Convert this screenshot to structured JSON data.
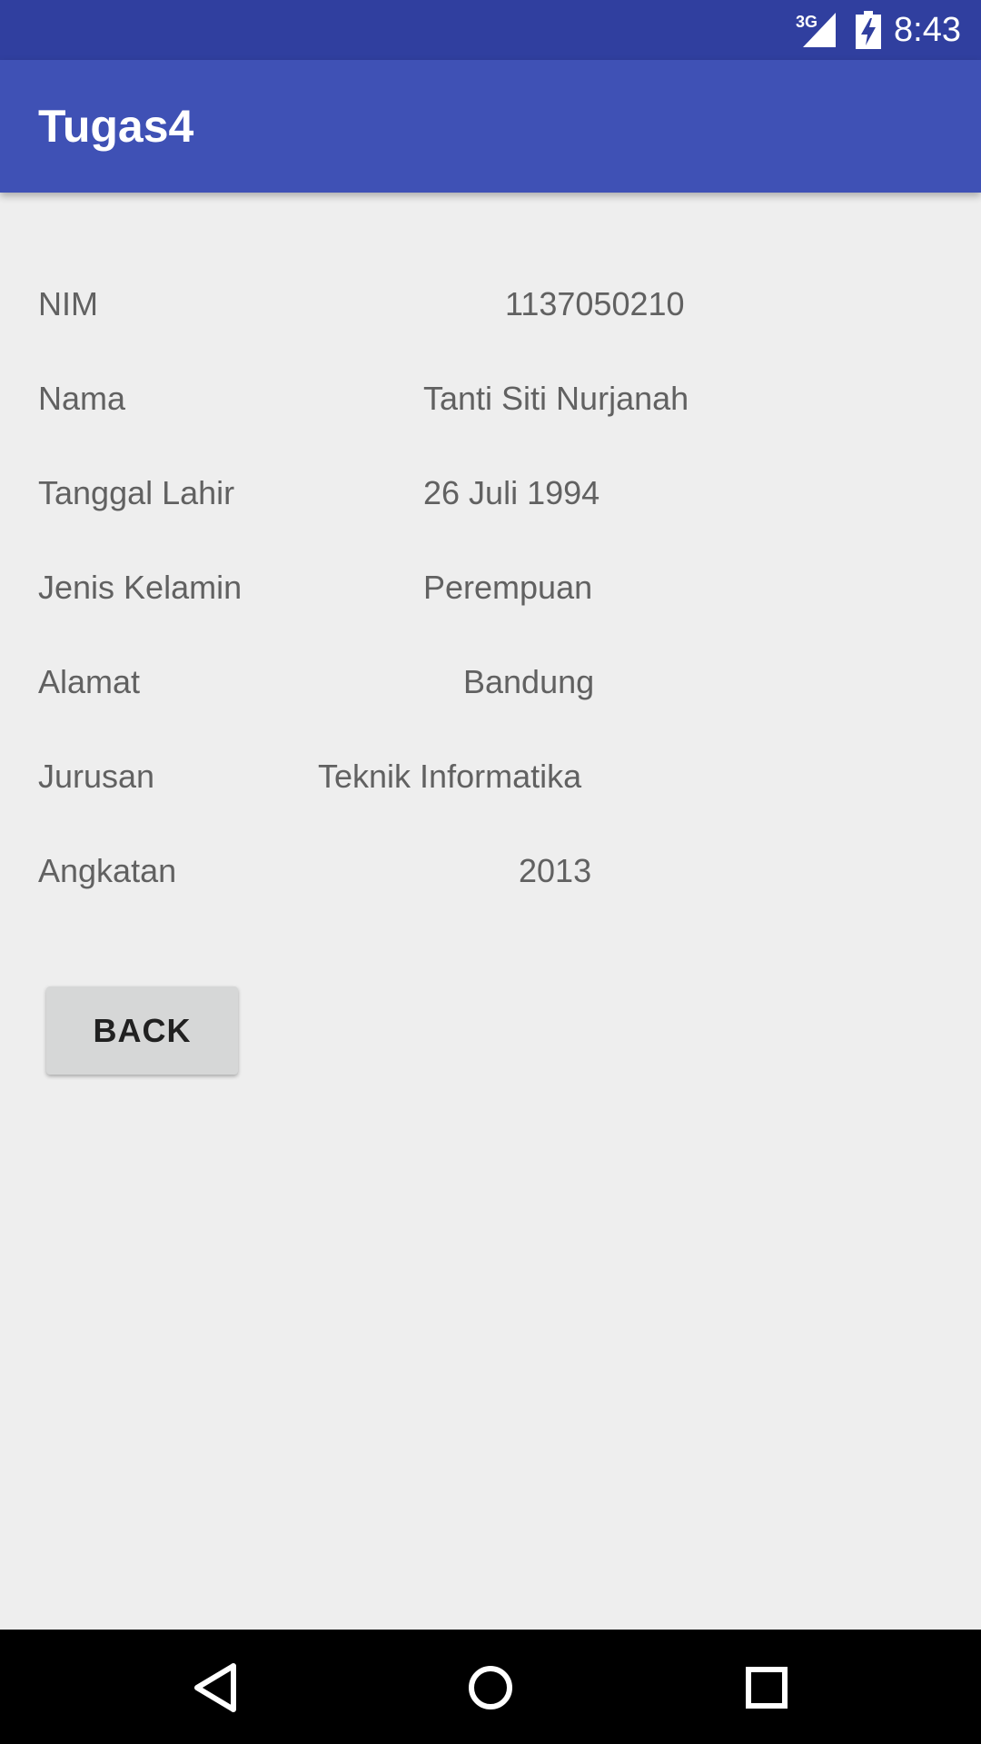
{
  "status_bar": {
    "network": "3G",
    "time": "8:43",
    "icons": [
      "signal-icon",
      "battery-charging-icon"
    ]
  },
  "app_bar": {
    "title": "Tugas4"
  },
  "profile": {
    "rows": [
      {
        "label": "NIM",
        "value": "1137050210"
      },
      {
        "label": "Nama",
        "value": "Tanti Siti Nurjanah"
      },
      {
        "label": "Tanggal Lahir",
        "value": "26 Juli 1994"
      },
      {
        "label": "Jenis Kelamin",
        "value": "Perempuan"
      },
      {
        "label": "Alamat",
        "value": "Bandung"
      },
      {
        "label": "Jurusan",
        "value": "Teknik Informatika"
      },
      {
        "label": "Angkatan",
        "value": "2013"
      }
    ]
  },
  "actions": {
    "back_label": "BACK"
  },
  "nav_bar": {
    "icons": [
      "back-icon",
      "home-icon",
      "recents-icon"
    ]
  },
  "colors": {
    "status_bar": "#303f9f",
    "app_bar": "#3f51b5",
    "background": "#eeeeee",
    "text": "#616161",
    "button": "#d6d7d7"
  }
}
